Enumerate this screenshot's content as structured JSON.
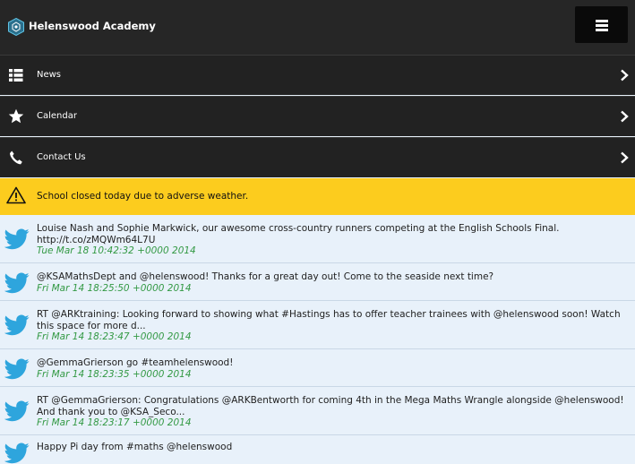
{
  "header": {
    "title": "Helenswood Academy",
    "logo_icon": "hexagon-logo-icon",
    "menu_icon": "hamburger-menu-icon"
  },
  "nav": {
    "items": [
      {
        "label": "News",
        "icon": "list-icon"
      },
      {
        "label": "Calendar",
        "icon": "star-icon"
      },
      {
        "label": "Contact Us",
        "icon": "phone-icon"
      }
    ]
  },
  "alert": {
    "text": "School closed today due to adverse weather.",
    "icon": "warning-icon",
    "color": "#fccc1e"
  },
  "tweets": [
    {
      "text": "Louise Nash and Sophie Markwick, our awesome cross-country runners competing at the English Schools Final. http://t.co/zMQWm64L7U",
      "time": "Tue Mar 18 10:42:32 +0000 2014"
    },
    {
      "text": "@KSAMathsDept and @helenswood! Thanks for a great day out! Come to the seaside next time?",
      "time": "Fri Mar 14 18:25:50 +0000 2014"
    },
    {
      "text": "RT @ARKtraining: Looking forward to showing what #Hastings has to offer teacher trainees with @helenswood soon! Watch this space for more d...",
      "time": "Fri Mar 14 18:23:47 +0000 2014"
    },
    {
      "text": "@GemmaGrierson go #teamhelenswood!",
      "time": "Fri Mar 14 18:23:35 +0000 2014"
    },
    {
      "text": "RT @GemmaGrierson: Congratulations @ARKBentworth for coming 4th in the Mega Maths Wrangle alongside @helenswood! And thank you to @KSA_Seco...",
      "time": "Fri Mar 14 18:23:17 +0000 2014"
    },
    {
      "text": "Happy Pi day from #maths @helenswood",
      "time": ""
    }
  ],
  "colors": {
    "header_bg": "#262626",
    "nav_bg": "#222222",
    "tweet_bg": "#e8f1fa",
    "timestamp": "#339944",
    "twitter_bird": "#2ea5dd"
  }
}
